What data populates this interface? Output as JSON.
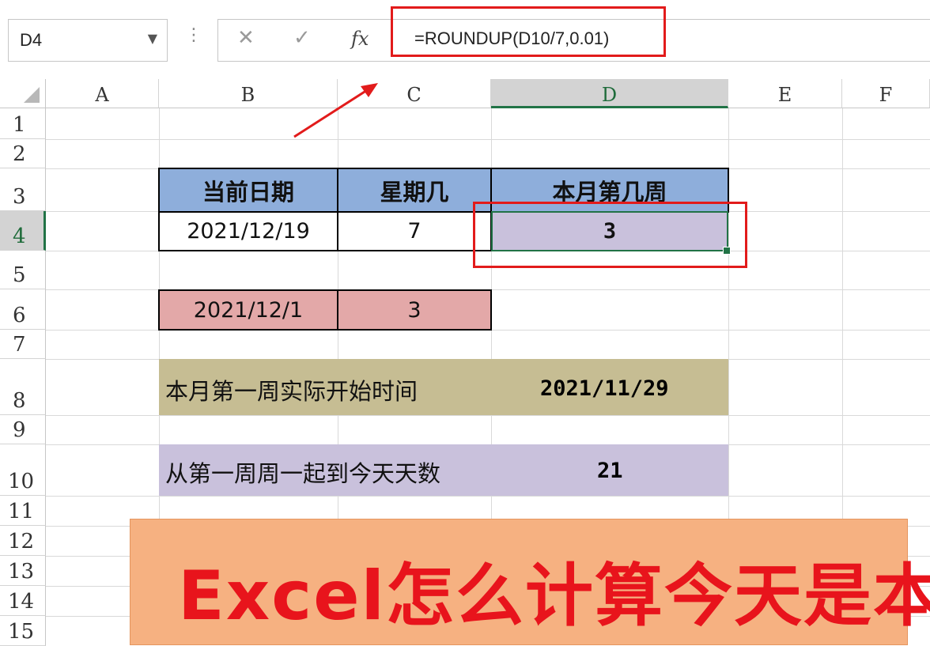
{
  "formula_bar": {
    "name_box": "D4",
    "cancel_icon": "✕",
    "enter_icon": "✓",
    "fx_label": "fx",
    "formula": "=ROUNDUP(D10/7,0.01)"
  },
  "columns": [
    "A",
    "B",
    "C",
    "D",
    "E",
    "F"
  ],
  "rows": [
    "1",
    "2",
    "3",
    "4",
    "5",
    "6",
    "7",
    "8",
    "9",
    "10",
    "11",
    "12",
    "13",
    "14",
    "15"
  ],
  "selected_cell": "D4",
  "table": {
    "headers": [
      "当前日期",
      "星期几",
      "本月第几周"
    ],
    "values": [
      "2021/12/19",
      "7",
      "3"
    ]
  },
  "month_start": {
    "date": "2021/12/1",
    "weekday": "3"
  },
  "first_week": {
    "label": "本月第一周实际开始时间",
    "value": "2021/11/29"
  },
  "days_count": {
    "label": "从第一周周一起到今天天数",
    "value": "21"
  },
  "banner": {
    "text": "Excel怎么计算今天是本"
  },
  "colors": {
    "header_fill": "#8eaedb",
    "pink_fill": "#e3a8a8",
    "olive_fill": "#c6bd93",
    "lavender_fill": "#c9c1dc",
    "highlight_red": "#e21b1b",
    "selection_green": "#217346",
    "banner_fill": "#f6b181",
    "banner_text": "#e8141c"
  }
}
